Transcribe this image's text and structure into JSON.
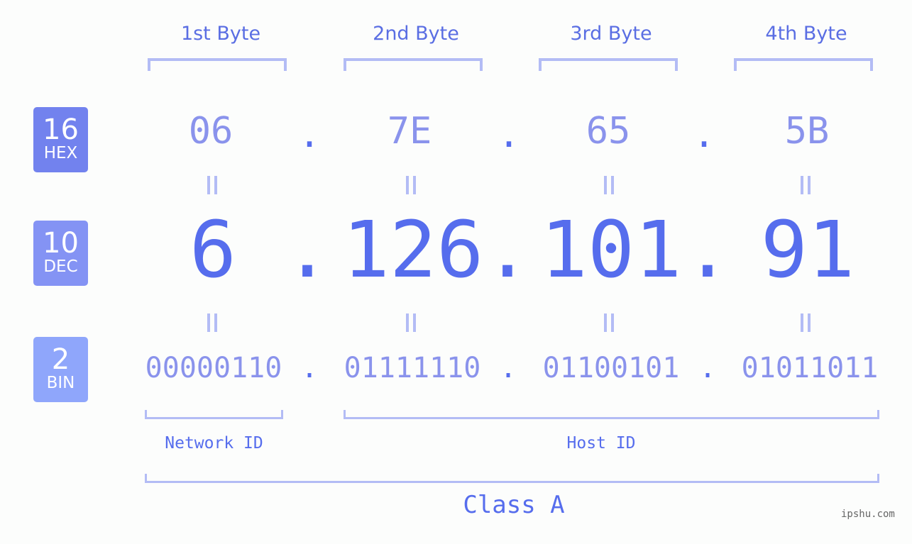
{
  "bytes": {
    "labels": [
      "1st Byte",
      "2nd Byte",
      "3rd Byte",
      "4th Byte"
    ]
  },
  "rows": {
    "hex": {
      "base": "16",
      "name": "HEX",
      "color": "#7282ee",
      "values": [
        "06",
        "7E",
        "65",
        "5B"
      ]
    },
    "dec": {
      "base": "10",
      "name": "DEC",
      "color": "#8493f4",
      "values": [
        "6",
        "126",
        "101",
        "91"
      ]
    },
    "bin": {
      "base": "2",
      "name": "BIN",
      "color": "#8fa6fb",
      "values": [
        "00000110",
        "01111110",
        "01100101",
        "01011011"
      ]
    }
  },
  "separator": ".",
  "ids": {
    "network": "Network ID",
    "host": "Host ID",
    "class": "Class A"
  },
  "watermark": "ipshu.com"
}
